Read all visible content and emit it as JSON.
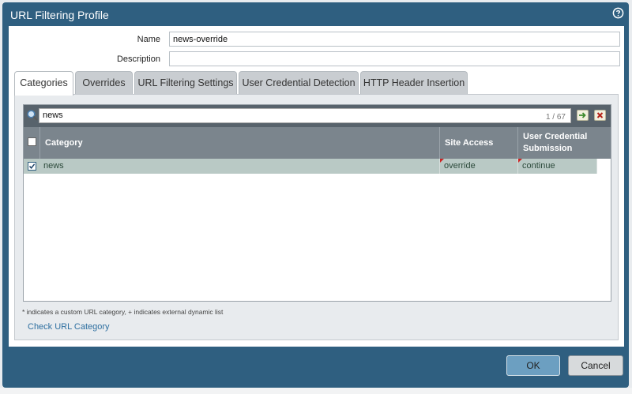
{
  "dialog": {
    "title": "URL Filtering Profile",
    "help_icon": "help-circle-icon"
  },
  "form": {
    "name_label": "Name",
    "name_value": "news-override",
    "description_label": "Description",
    "description_value": ""
  },
  "tabs": [
    {
      "label": "Categories",
      "active": true
    },
    {
      "label": "Overrides",
      "active": false
    },
    {
      "label": "URL Filtering Settings",
      "active": false
    },
    {
      "label": "User Credential Detection",
      "active": false
    },
    {
      "label": "HTTP Header Insertion",
      "active": false
    }
  ],
  "search": {
    "value": "news",
    "count": "1 / 67"
  },
  "table": {
    "headers": [
      "Category",
      "Site Access",
      "User Credential",
      "Submission"
    ],
    "rows": [
      {
        "checked": true,
        "category": "news",
        "site_access": "override",
        "user_credential_submission": "continue"
      }
    ]
  },
  "footnote": "* indicates a custom URL category, + indicates external dynamic list",
  "check_link": "Check URL Category",
  "buttons": {
    "ok": "OK",
    "cancel": "Cancel"
  },
  "colors": {
    "dialog_bg": "#2f5f80",
    "header_bg": "#7b858d",
    "selected_row": "#b9c9c5",
    "ok_button": "#6c9fc1",
    "link": "#2e6fa0"
  }
}
